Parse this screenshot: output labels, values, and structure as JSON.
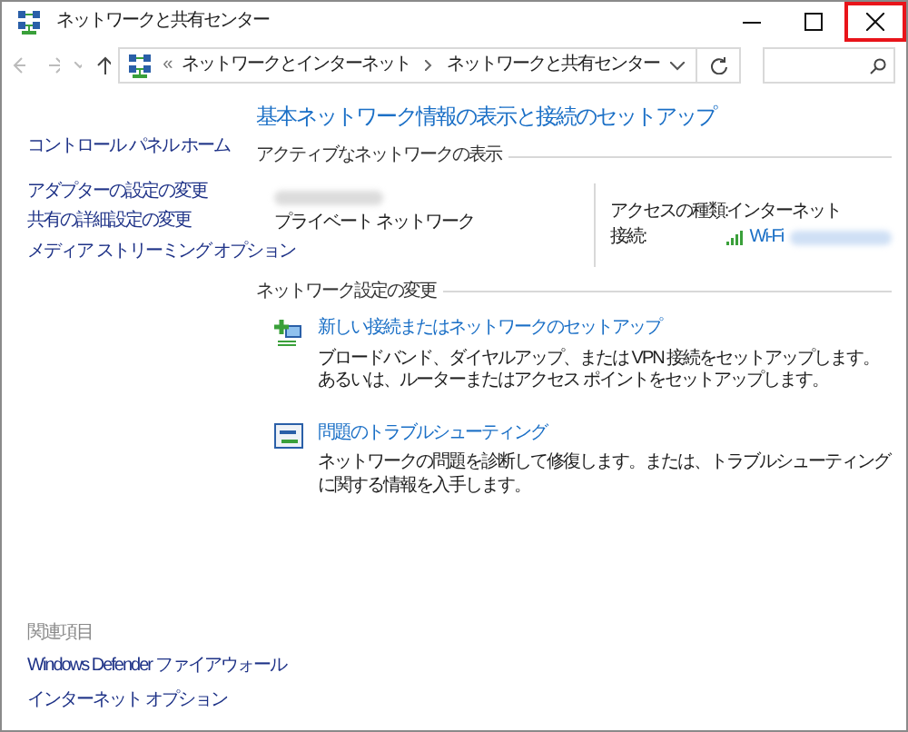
{
  "window": {
    "title": "ネットワークと共有センター",
    "close_highlighted": true
  },
  "address_bar": {
    "crumbs": [
      "ネットワークとインターネット",
      "ネットワークと共有センター"
    ],
    "overflow": "«"
  },
  "sidebar": {
    "items": [
      {
        "label": "コントロール パネル ホーム"
      },
      {
        "label": "アダプターの設定の変更"
      },
      {
        "label": "共有の詳細設定の変更"
      },
      {
        "label": "メディア ストリーミング オプション"
      }
    ],
    "related_heading": "関連項目",
    "related": [
      {
        "label": "Windows Defender ファイアウォール"
      },
      {
        "label": "インターネット オプション"
      }
    ]
  },
  "main": {
    "heading": "基本ネットワーク情報の表示と接続のセットアップ",
    "active_section": "アクティブなネットワークの表示",
    "network": {
      "type": "プライベート ネットワーク",
      "access_label": "アクセスの種類:",
      "access_value": "インターネット",
      "connection_label": "接続:",
      "connection_value": "Wi-Fi"
    },
    "settings_section": "ネットワーク設定の変更",
    "tasks": [
      {
        "kind": "setup",
        "title": "新しい接続またはネットワークのセットアップ",
        "description": "ブロードバンド、ダイヤルアップ、または VPN 接続をセットアップします。あるいは、ルーターまたはアクセス ポイントをセットアップします。"
      },
      {
        "kind": "troubleshoot",
        "title": "問題のトラブルシューティング",
        "description": "ネットワークの問題を診断して修復します。または、トラブルシューティングに関する情報を入手します。"
      }
    ]
  }
}
